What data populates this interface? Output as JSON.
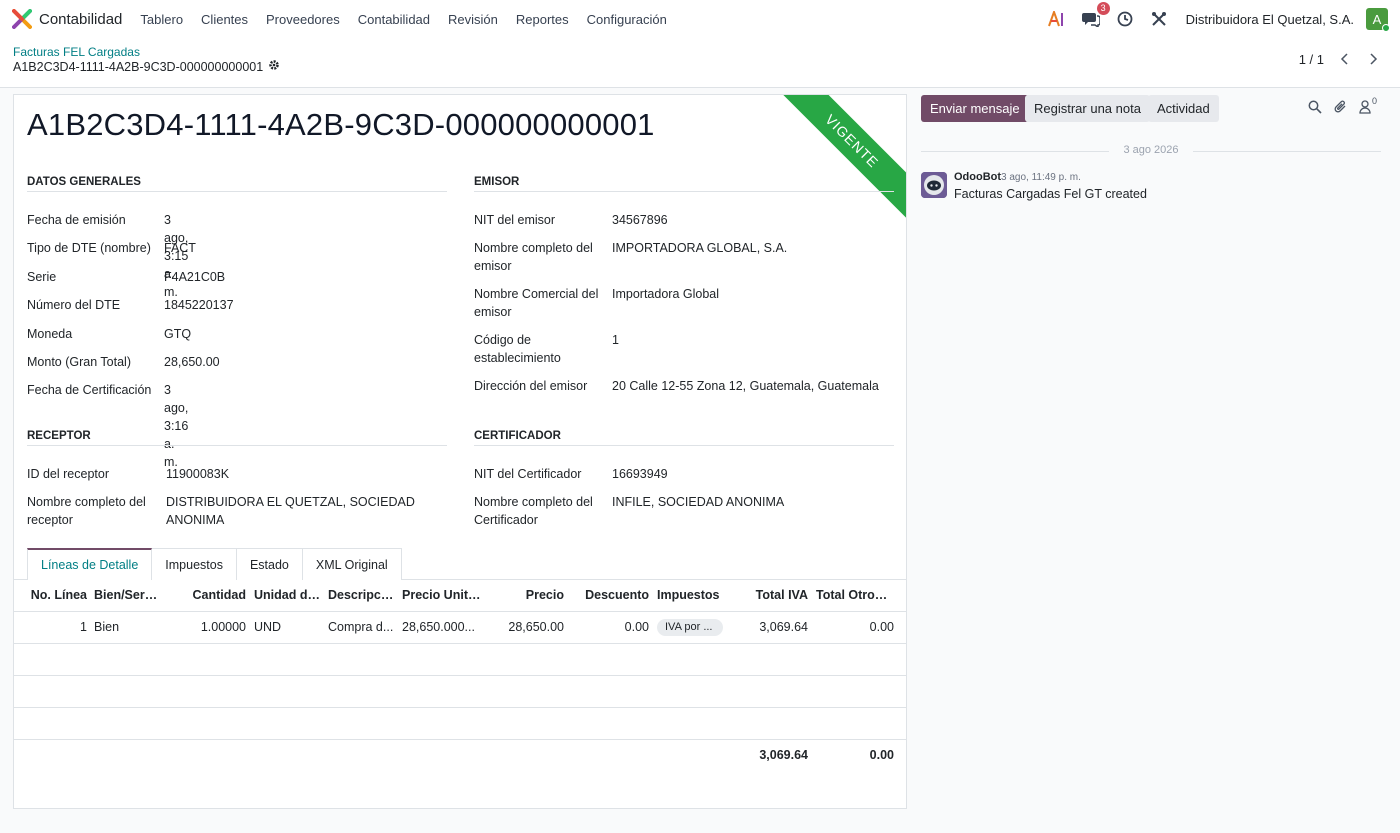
{
  "navbar": {
    "app_name": "Contabilidad",
    "menu": [
      "Tablero",
      "Clientes",
      "Proveedores",
      "Contabilidad",
      "Revisión",
      "Reportes",
      "Configuración"
    ],
    "messages_badge": "3",
    "company": "Distribuidora El Quetzal, S.A.",
    "avatar_letter": "A"
  },
  "control": {
    "breadcrumb_parent": "Facturas FEL Cargadas",
    "breadcrumb_current": "A1B2C3D4-1111-4A2B-9C3D-000000000001",
    "pager": "1 / 1"
  },
  "form": {
    "title": "A1B2C3D4-1111-4A2B-9C3D-000000000001",
    "ribbon": "VIGENTE",
    "datos_generales": {
      "title": "DATOS GENERALES",
      "fields": [
        {
          "label": "Fecha de emisión",
          "value": "3 ago, 3:15 a. m."
        },
        {
          "label": "Tipo de DTE (nombre)",
          "value": "FACT"
        },
        {
          "label": "Serie",
          "value": "F4A21C0B"
        },
        {
          "label": "Número del DTE",
          "value": "1845220137"
        },
        {
          "label": "Moneda",
          "value": "GTQ"
        },
        {
          "label": "Monto (Gran Total)",
          "value": "28,650.00"
        },
        {
          "label": "Fecha de Certificación",
          "value": "3 ago, 3:16 a. m."
        }
      ]
    },
    "emisor": {
      "title": "EMISOR",
      "fields": [
        {
          "label": "NIT del emisor",
          "value": "34567896"
        },
        {
          "label": "Nombre completo del emisor",
          "value": "IMPORTADORA GLOBAL, S.A."
        },
        {
          "label": "Nombre Comercial del emisor",
          "value": "Importadora Global"
        },
        {
          "label": "Código de establecimiento",
          "value": "1"
        },
        {
          "label": "Dirección del emisor",
          "value": "20 Calle 12-55 Zona 12, Guatemala, Guatemala"
        }
      ]
    },
    "receptor": {
      "title": "RECEPTOR",
      "fields": [
        {
          "label": "ID del receptor",
          "value": "11900083K"
        },
        {
          "label": "Nombre completo del receptor",
          "value": "DISTRIBUIDORA EL QUETZAL, SOCIEDAD ANONIMA"
        }
      ]
    },
    "certificador": {
      "title": "CERTIFICADOR",
      "fields": [
        {
          "label": "NIT del Certificador",
          "value": "16693949"
        },
        {
          "label": "Nombre completo del Certificador",
          "value": "INFILE, SOCIEDAD ANONIMA"
        }
      ]
    },
    "tabs": [
      "Líneas de Detalle",
      "Impuestos",
      "Estado",
      "XML Original"
    ],
    "table": {
      "headers": [
        "No. Línea",
        "Bien/Servi...",
        "Cantidad",
        "Unidad de...",
        "Descripción",
        "Precio Unita...",
        "Precio",
        "Descuento",
        "Impuestos",
        "Total IVA",
        "Total Otros I..."
      ],
      "rows": [
        [
          "1",
          "Bien",
          "1.00000",
          "UND",
          "Compra d...",
          "28,650.000...",
          "28,650.00",
          "0.00",
          "IVA por ...",
          "3,069.64",
          "0.00"
        ]
      ],
      "totals": {
        "total_iva": "3,069.64",
        "total_otros": "0.00"
      }
    }
  },
  "chatter": {
    "send_message": "Enviar mensaje",
    "log_note": "Registrar una nota",
    "activity": "Actividad",
    "followers_count": "0",
    "date_separator": "3 ago 2026",
    "message": {
      "author": "OdooBot",
      "time": "3 ago, 11:49 p. m.",
      "body": "Facturas Cargadas Fel GT created"
    }
  }
}
